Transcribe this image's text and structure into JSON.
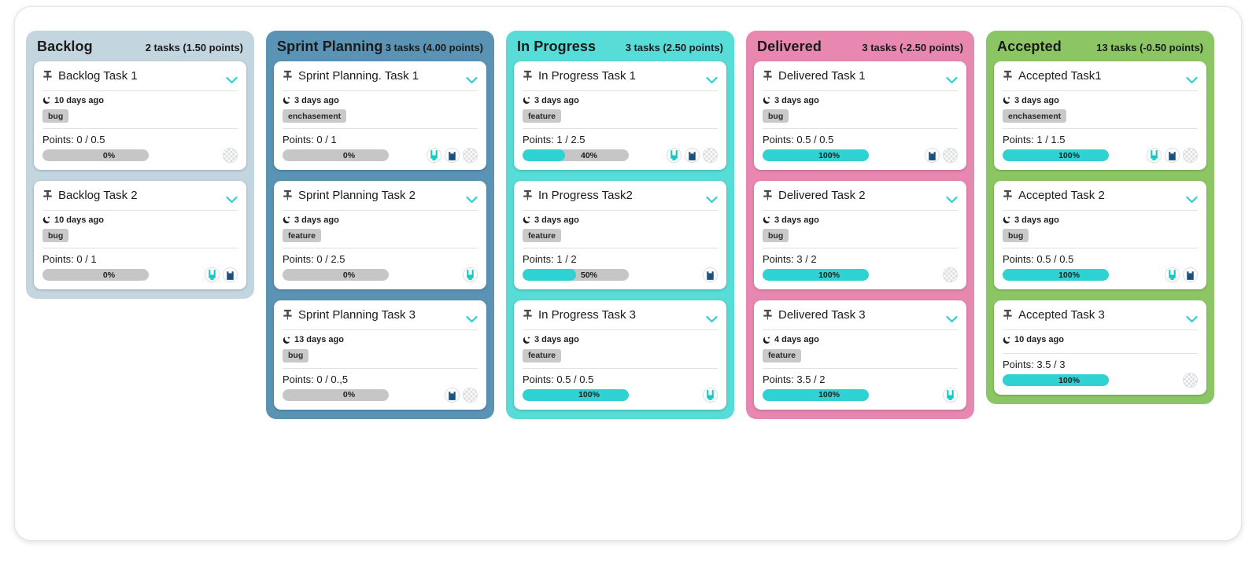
{
  "board": {
    "columns": [
      {
        "id": "backlog",
        "title": "Backlog",
        "count": "2 tasks (1.50 points)",
        "color": "#c3d6e0",
        "cards": [
          {
            "title": "Backlog Task 1",
            "time": "10 days ago",
            "tag": "bug",
            "points": "Points: 0 / 0.5",
            "percent": "0%",
            "fill": 0,
            "avatars": [
              "checker"
            ]
          },
          {
            "title": "Backlog Task 2",
            "time": "10 days ago",
            "tag": "bug",
            "points": "Points: 0 / 1",
            "percent": "0%",
            "fill": 0,
            "avatars": [
              "teal-u",
              "navy-n"
            ]
          }
        ]
      },
      {
        "id": "sprint-planning",
        "title": "Sprint Planning",
        "count": "3 tasks (4.00 points)",
        "color": "#5b93b5",
        "cards": [
          {
            "title": "Sprint Planning. Task 1",
            "time": "3 days ago",
            "tag": "enchasement",
            "points": "Points: 0 / 1",
            "percent": "0%",
            "fill": 0,
            "avatars": [
              "teal-u",
              "navy-n",
              "checker"
            ]
          },
          {
            "title": "Sprint Planning Task 2",
            "time": "3 days ago",
            "tag": "feature",
            "points": "Points: 0 / 2.5",
            "percent": "0%",
            "fill": 0,
            "avatars": [
              "teal-u"
            ]
          },
          {
            "title": "Sprint Planning Task 3",
            "time": "13 days ago",
            "tag": "bug",
            "points": "Points: 0 / 0.,5",
            "percent": "0%",
            "fill": 0,
            "avatars": [
              "navy-n",
              "checker"
            ]
          }
        ]
      },
      {
        "id": "in-progress",
        "title": "In Progress",
        "count": "3 tasks (2.50 points)",
        "color": "#58dcd8",
        "cards": [
          {
            "title": "In Progress Task 1",
            "time": "3 days ago",
            "tag": "feature",
            "points": "Points: 1 / 2.5",
            "percent": "40%",
            "fill": 40,
            "avatars": [
              "teal-u",
              "navy-n",
              "checker"
            ]
          },
          {
            "title": "In Progress Task2",
            "time": "3 days ago",
            "tag": "feature",
            "points": "Points: 1 / 2",
            "percent": "50%",
            "fill": 50,
            "avatars": [
              "navy-n"
            ]
          },
          {
            "title": "In Progress Task 3",
            "time": "3 days ago",
            "tag": "feature",
            "points": "Points: 0.5 / 0.5",
            "percent": "100%",
            "fill": 100,
            "avatars": [
              "teal-u"
            ]
          }
        ]
      },
      {
        "id": "delivered",
        "title": "Delivered",
        "count": "3 tasks (-2.50 points)",
        "color": "#e887b0",
        "cards": [
          {
            "title": "Delivered Task 1",
            "time": "3 days ago",
            "tag": "bug",
            "points": "Points: 0.5 / 0.5",
            "percent": "100%",
            "fill": 100,
            "avatars": [
              "navy-n",
              "checker"
            ]
          },
          {
            "title": "Delivered Task 2",
            "time": "3 days ago",
            "tag": "bug",
            "points": "Points: 3 / 2",
            "percent": "100%",
            "fill": 100,
            "avatars": [
              "checker"
            ]
          },
          {
            "title": "Delivered Task 3",
            "time": "4 days ago",
            "tag": "feature",
            "points": "Points: 3.5 / 2",
            "percent": "100%",
            "fill": 100,
            "avatars": [
              "teal-u"
            ]
          }
        ]
      },
      {
        "id": "accepted",
        "title": "Accepted",
        "count": "13 tasks (-0.50 points)",
        "color": "#8cc664",
        "cards": [
          {
            "title": "Accepted Task1",
            "time": "3 days ago",
            "tag": "enchasement",
            "points": "Points: 1 / 1.5",
            "percent": "100%",
            "fill": 100,
            "avatars": [
              "teal-u",
              "navy-n",
              "checker"
            ]
          },
          {
            "title": "Accepted Task 2",
            "time": "3 days ago",
            "tag": "bug",
            "points": "Points: 0.5 / 0.5",
            "percent": "100%",
            "fill": 100,
            "avatars": [
              "teal-u",
              "navy-n"
            ]
          },
          {
            "title": "Accepted Task 3",
            "time": "10 days ago",
            "tag": "",
            "points": "Points: 3.5 / 3",
            "percent": "100%",
            "fill": 100,
            "avatars": [
              "checker"
            ]
          }
        ]
      }
    ]
  },
  "icons": {
    "pin": "pin-icon",
    "moon": "moon-icon",
    "chevron": "chevron-down-icon"
  },
  "colors": {
    "progress_fill": "#2fd2d2",
    "progress_track": "#c6c6c6",
    "chevron": "#2fd0d0",
    "tag_bg": "#c9c9c9"
  }
}
